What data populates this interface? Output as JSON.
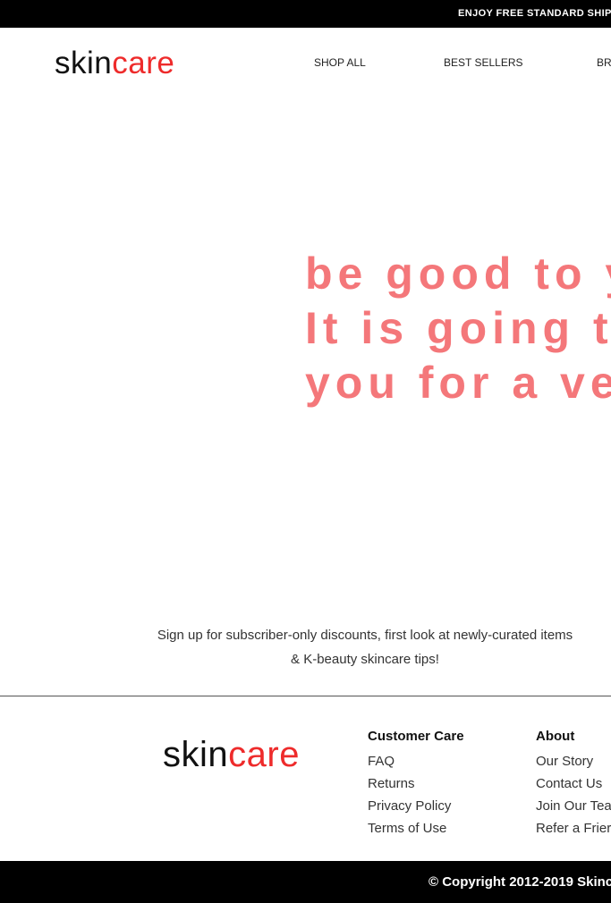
{
  "announcement": {
    "text": "ENJOY FREE STANDARD SHIPPING"
  },
  "brand": {
    "part1": "skin",
    "part2": "care",
    "accent_color": "#ee2b2b"
  },
  "nav": {
    "items": [
      "SHOP ALL",
      "BEST SELLERS",
      "BR"
    ]
  },
  "hero": {
    "lines": [
      "be good to yo",
      "It is going to",
      "you for a very"
    ],
    "color": "#f4777a"
  },
  "signup": {
    "line1": "Sign up for subscriber-only discounts, first look at newly-curated items",
    "line2": "& K-beauty skincare tips!"
  },
  "footer": {
    "customer_care": {
      "title": "Customer Care",
      "links": [
        "FAQ",
        "Returns",
        "Privacy Policy",
        "Terms of Use"
      ]
    },
    "about": {
      "title": "About",
      "links": [
        "Our Story",
        "Contact Us",
        "Join Our Tea",
        "Refer a Frier"
      ]
    },
    "copyright": "© Copyright 2012-2019 Skinc"
  }
}
